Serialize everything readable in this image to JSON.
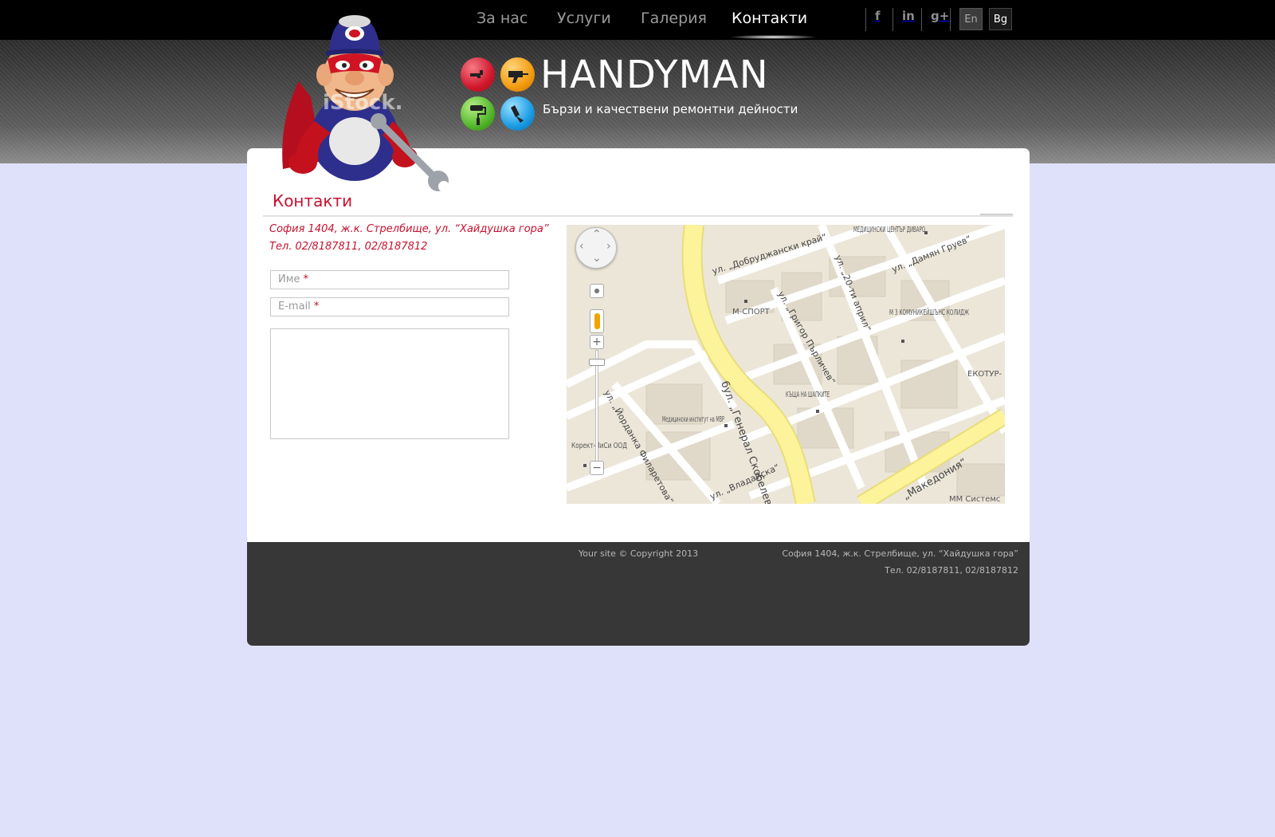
{
  "nav": {
    "items": [
      {
        "label": "За нас",
        "active": false
      },
      {
        "label": "Услуги",
        "active": false
      },
      {
        "label": "Галерия",
        "active": false
      },
      {
        "label": "Контакти",
        "active": true
      }
    ]
  },
  "social": {
    "facebook": "f",
    "linkedin": "in",
    "googleplus": "g+"
  },
  "languages": {
    "en": "En",
    "bg": "Bg"
  },
  "brand": {
    "name": "HANDYMAN",
    "tagline": "Бързи и качествени ремонтни дейности",
    "watermark": "iStock."
  },
  "page": {
    "title": "Контакти",
    "address": "София 1404, ж.к. Стрелбище, ул. “Хайдушка гора”",
    "phone": "Тел. 02/8187811, 02/8187812"
  },
  "form": {
    "name_placeholder": "Име",
    "email_placeholder": "E-mail",
    "required_mark": "*"
  },
  "map": {
    "labels": [
      "МЕДИЦИНСКИ ЦЕНТЪР ДИВАРО",
      "М-СПОРТ",
      "М 3 КОМУНИКЕЙШЪНС КОЛИДЖ",
      "ЕКОТУР-",
      "КЪЩА НА ШАПКИТЕ",
      "Медицински институт на МВР",
      "Корект-ПиСи ООД",
      "бул. „Генерал Скобелев“",
      "ул. „Добруджански край“",
      "ул. „Дамян Груев“",
      "ул. „20-ти април“",
      "ул. „Григор Пърличев“",
      "ул. „Йорданка Филаретова“",
      "ул. „Владайска“",
      "„Македония“",
      "ММ Системс"
    ]
  },
  "footer": {
    "copyright": "Your site © Copyright 2013",
    "address": "София 1404, ж.к. Стрелбище, ул. “Хайдушка гора”",
    "phone": "Тел. 02/8187811, 02/8187812"
  },
  "colors": {
    "accent": "#c8102e",
    "topbar": "#000000",
    "page_bg": "#dfe1fb",
    "footer_bg": "#373737"
  }
}
